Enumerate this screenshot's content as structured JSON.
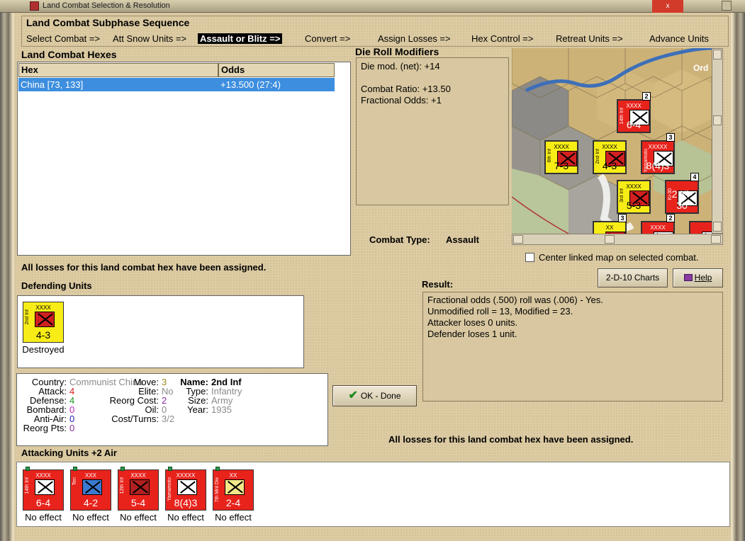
{
  "window": {
    "title": "Land Combat Selection & Resolution",
    "close_label": "x"
  },
  "sequence": {
    "title": "Land Combat Subphase Sequence",
    "phases": [
      {
        "label": "Select Combat =>"
      },
      {
        "label": "Att Snow Units =>"
      },
      {
        "label": "Assault or Blitz =>",
        "active": true
      },
      {
        "label": "Convert =>"
      },
      {
        "label": "Assign Losses =>"
      },
      {
        "label": "Hex Control =>"
      },
      {
        "label": "Retreat Units =>"
      },
      {
        "label": "Advance Units"
      }
    ]
  },
  "hexes": {
    "title": "Land Combat Hexes",
    "columns": [
      "Hex",
      "Odds"
    ],
    "rows": [
      {
        "hex": "China [73, 133]",
        "odds": "+13.500 (27:4)"
      }
    ]
  },
  "die_roll": {
    "title": "Die Roll Modifiers",
    "lines": [
      "Die mod. (net): +14",
      "",
      "Combat Ratio: +13.50",
      "Fractional Odds: +1"
    ]
  },
  "combat_type": {
    "label": "Combat Type:",
    "value": "Assault"
  },
  "map": {
    "center_label": "Center linked map on selected combat.",
    "center_checked": false,
    "corner_text": "Ord",
    "counters": [
      {
        "name": "14th Inf",
        "size": "XXXX",
        "values": "6-4",
        "bg": "#e8231c",
        "stack": "2"
      },
      {
        "name": "6th Inf",
        "size": "XXXX",
        "values": "7-3",
        "bg": "#f7ec16"
      },
      {
        "name": "2nd Inf",
        "size": "XXXX",
        "values": "4-3",
        "bg": "#f7ec16"
      },
      {
        "name": "Yamamoto",
        "size": "XXXXX",
        "values": "8(4)3",
        "bg": "#e8231c",
        "stack": "3"
      },
      {
        "name": "3rd Inf",
        "size": "XXXX",
        "values": "5-3",
        "bg": "#f7ec16"
      },
      {
        "name": "Ki-30",
        "size": "",
        "values": "2 Ki-30",
        "bg": "#e8231c",
        "stack": "4"
      },
      {
        "name": "",
        "size": "XX",
        "values": "",
        "bg": "#f7ec16",
        "stack": "3"
      },
      {
        "name": "",
        "size": "XXXX",
        "values": "",
        "bg": "#e8231c",
        "stack": "2"
      },
      {
        "name": "",
        "size": "",
        "values": "",
        "bg": "#e8231c"
      }
    ]
  },
  "buttons": {
    "charts": "2-D-10 Charts",
    "help": "Help",
    "ok": "OK - Done"
  },
  "losses_msg_top": "All losses for this land combat hex have been assigned.",
  "losses_msg_bottom": "All losses for this land combat hex have been assigned.",
  "defending": {
    "title": "Defending Units",
    "units": [
      {
        "name": "2nd Inf",
        "size": "XXXX",
        "values": "4-3",
        "bg": "#f7ec16",
        "status": "Destroyed"
      }
    ]
  },
  "result": {
    "title": "Result:",
    "lines": [
      "Fractional odds (.500) roll was (.006)  - Yes.",
      "Unmodified roll = 13, Modified = 23.",
      "Attacker loses 0 units.",
      "Defender loses 1 unit."
    ]
  },
  "unit_info": {
    "left": [
      {
        "k": "Country:",
        "v": "Communist China",
        "c": "#8a8a8a"
      },
      {
        "k": "Attack:",
        "v": "4",
        "c": "#e02020"
      },
      {
        "k": "Defense:",
        "v": "4",
        "c": "#1a9a1a"
      },
      {
        "k": "Bombard:",
        "v": "0",
        "c": "#c020c0"
      },
      {
        "k": "Anti-Air:",
        "v": "0",
        "c": "#2020c0"
      },
      {
        "k": "Reorg Pts:",
        "v": "0",
        "c": "#8a2aa0"
      }
    ],
    "middle": [
      {
        "k": "Move:",
        "v": "3",
        "c": "#9a8a1a"
      },
      {
        "k": "Elite:",
        "v": "No",
        "c": "#8a8a8a"
      },
      {
        "k": "Reorg Cost:",
        "v": "2",
        "c": "#8a2aa0"
      },
      {
        "k": "Oil:",
        "v": "0",
        "c": "#8a8a8a"
      },
      {
        "k": "Cost/Turns:",
        "v": "3/2",
        "c": "#8a8a8a"
      }
    ],
    "right": [
      {
        "k": "Name:",
        "v": "2nd Inf",
        "c": "#000",
        "bold": true
      },
      {
        "k": "Type:",
        "v": "Infantry",
        "c": "#8a8a8a"
      },
      {
        "k": "Size:",
        "v": "Army",
        "c": "#8a8a8a"
      },
      {
        "k": "Year:",
        "v": "1935",
        "c": "#8a8a8a"
      }
    ]
  },
  "attacking": {
    "title": "Attacking Units +2 Air",
    "units": [
      {
        "name": "14th Inf",
        "size": "XXXX",
        "values": "6-4",
        "bg": "#e8231c",
        "status": "No effect"
      },
      {
        "name": "Ten",
        "size": "XXX",
        "values": "4-2",
        "bg": "#e8231c",
        "status": "No effect",
        "type": "blue"
      },
      {
        "name": "12th Inf",
        "size": "XXXX",
        "values": "5-4",
        "bg": "#e8231c",
        "status": "No effect",
        "type": "dark"
      },
      {
        "name": "Yamamoto",
        "size": "XXXXX",
        "values": "8(4)3",
        "bg": "#e8231c",
        "status": "No effect"
      },
      {
        "name": "7th Mnt Div",
        "size": "XX",
        "values": "2-4",
        "bg": "#e8231c",
        "status": "No effect",
        "type": "yellow"
      }
    ]
  }
}
